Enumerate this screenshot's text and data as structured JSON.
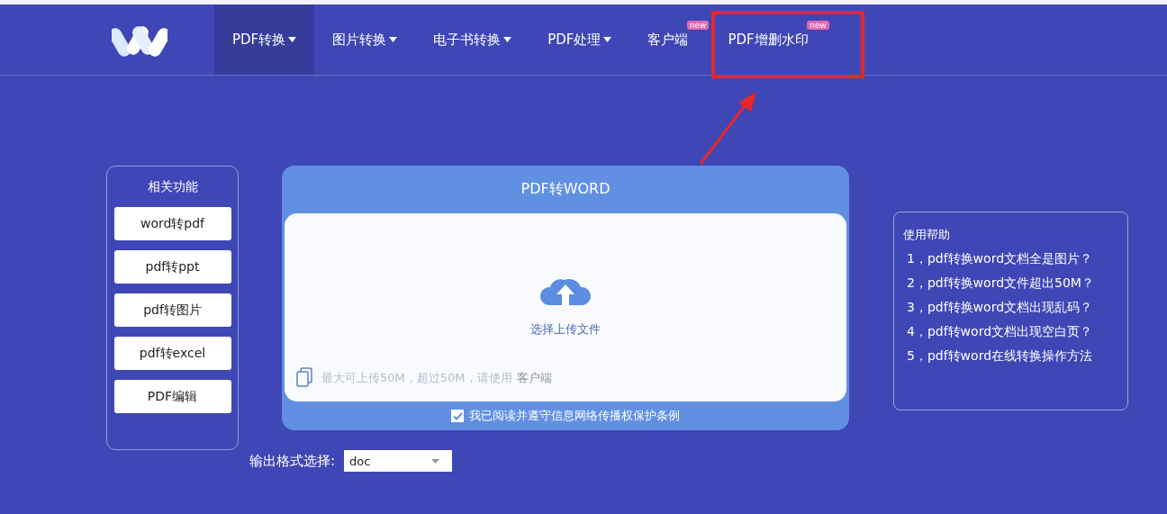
{
  "nav": {
    "items": [
      {
        "label": "PDF转换",
        "dropdown": true,
        "selected": true,
        "highlighted": false
      },
      {
        "label": "图片转换",
        "dropdown": true,
        "selected": false,
        "highlighted": false
      },
      {
        "label": "电子书转换",
        "dropdown": true,
        "selected": false,
        "highlighted": false
      },
      {
        "label": "PDF处理",
        "dropdown": true,
        "selected": false,
        "highlighted": false
      },
      {
        "label": "客户端",
        "dropdown": false,
        "selected": false,
        "badge": "new",
        "highlighted": false
      },
      {
        "label": "PDF增删水印",
        "dropdown": false,
        "selected": false,
        "badge": "new",
        "highlighted": true
      }
    ]
  },
  "related": {
    "title": "相关功能",
    "items": [
      "word转pdf",
      "pdf转ppt",
      "pdf转图片",
      "pdf转excel",
      "PDF编辑"
    ]
  },
  "converter": {
    "title": "PDF转WORD",
    "upload_label": "选择上传文件",
    "hint": "最大可上传50M，超过50M，请使用",
    "hint_link": "客户端",
    "agreement": {
      "label": "我已阅读并遵守信息网络传播权保护条例",
      "checked": true
    }
  },
  "help": {
    "title": "使用帮助",
    "items": [
      "1，pdf转换word文档全是图片？",
      "2，pdf转换word文件超出50M？",
      "3，pdf转换word文档出现乱码？",
      "4，pdf转word文档出现空白页？",
      "5，pdf转word在线转换操作方法"
    ]
  },
  "format": {
    "label": "输出格式选择:",
    "value": "doc"
  }
}
